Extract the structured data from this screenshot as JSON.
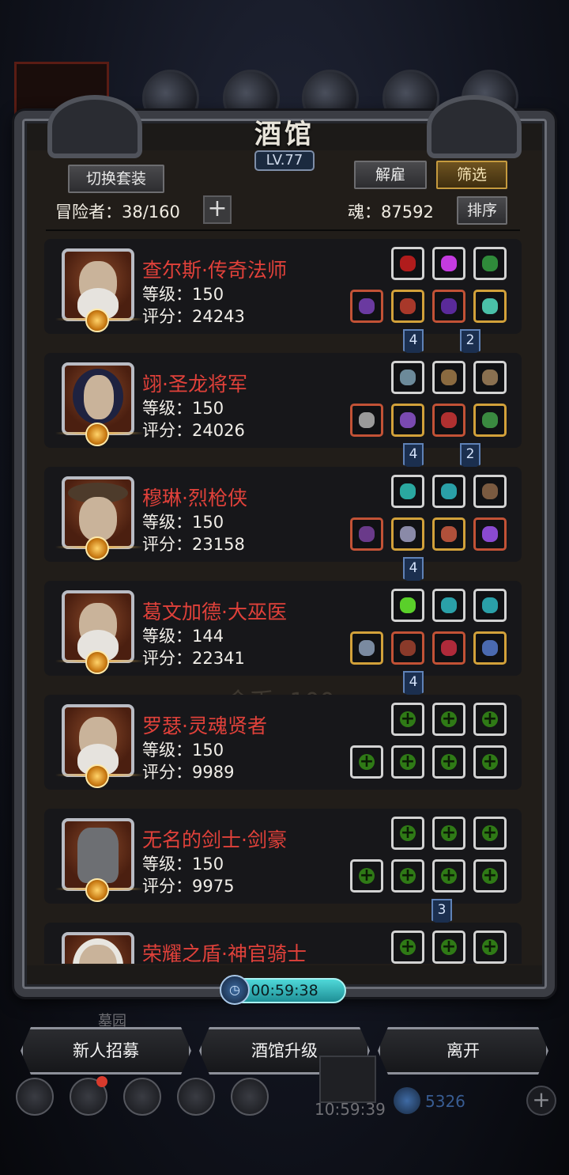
{
  "window": {
    "title": "酒馆",
    "level": "LV.77"
  },
  "header": {
    "switch_set_label": "切换套装",
    "dismiss_label": "解雇",
    "filter_label": "筛选",
    "sort_label": "排序",
    "adventurers_label": "冒险者：38/160",
    "soul_label": "魂：87592"
  },
  "adventurers": [
    {
      "name": "查尔斯·传奇法师",
      "level": "等级：150",
      "score": "评分：24243",
      "portrait": "old-wizard"
    },
    {
      "name": "翊·圣龙将军",
      "level": "等级：150",
      "score": "评分：24026",
      "portrait": "blue-hair-warrior"
    },
    {
      "name": "穆琳·烈枪侠",
      "level": "等级：150",
      "score": "评分：23158",
      "portrait": "cowboy-hat"
    },
    {
      "name": "葛文加德·大巫医",
      "level": "等级：144",
      "score": "评分：22341",
      "portrait": "old-wizard"
    },
    {
      "name": "罗瑟·灵魂贤者",
      "level": "等级：150",
      "score": "评分：9989",
      "portrait": "old-wizard"
    },
    {
      "name": "无名的剑士·剑豪",
      "level": "等级：150",
      "score": "评分：9975",
      "portrait": "iron-helmet"
    },
    {
      "name": "荣耀之盾·神官骑士",
      "portrait": "white-hair"
    }
  ],
  "link_tags": [
    "4",
    "2",
    "4",
    "2",
    "4",
    "4",
    "3"
  ],
  "ghost_text": "金币 -100",
  "timer": "00:59:38",
  "buttons": {
    "recruit": "新人招募",
    "upgrade": "酒馆升级",
    "leave": "离开"
  },
  "background": {
    "graveyard_label": "墓园",
    "clock": "10:59:39",
    "gems": "5326"
  },
  "colors": {
    "name_red": "#e0413a",
    "add_green": "#2f7a16",
    "timer_cyan": "#4fd8d8",
    "gold_border": "#d2a13a"
  }
}
